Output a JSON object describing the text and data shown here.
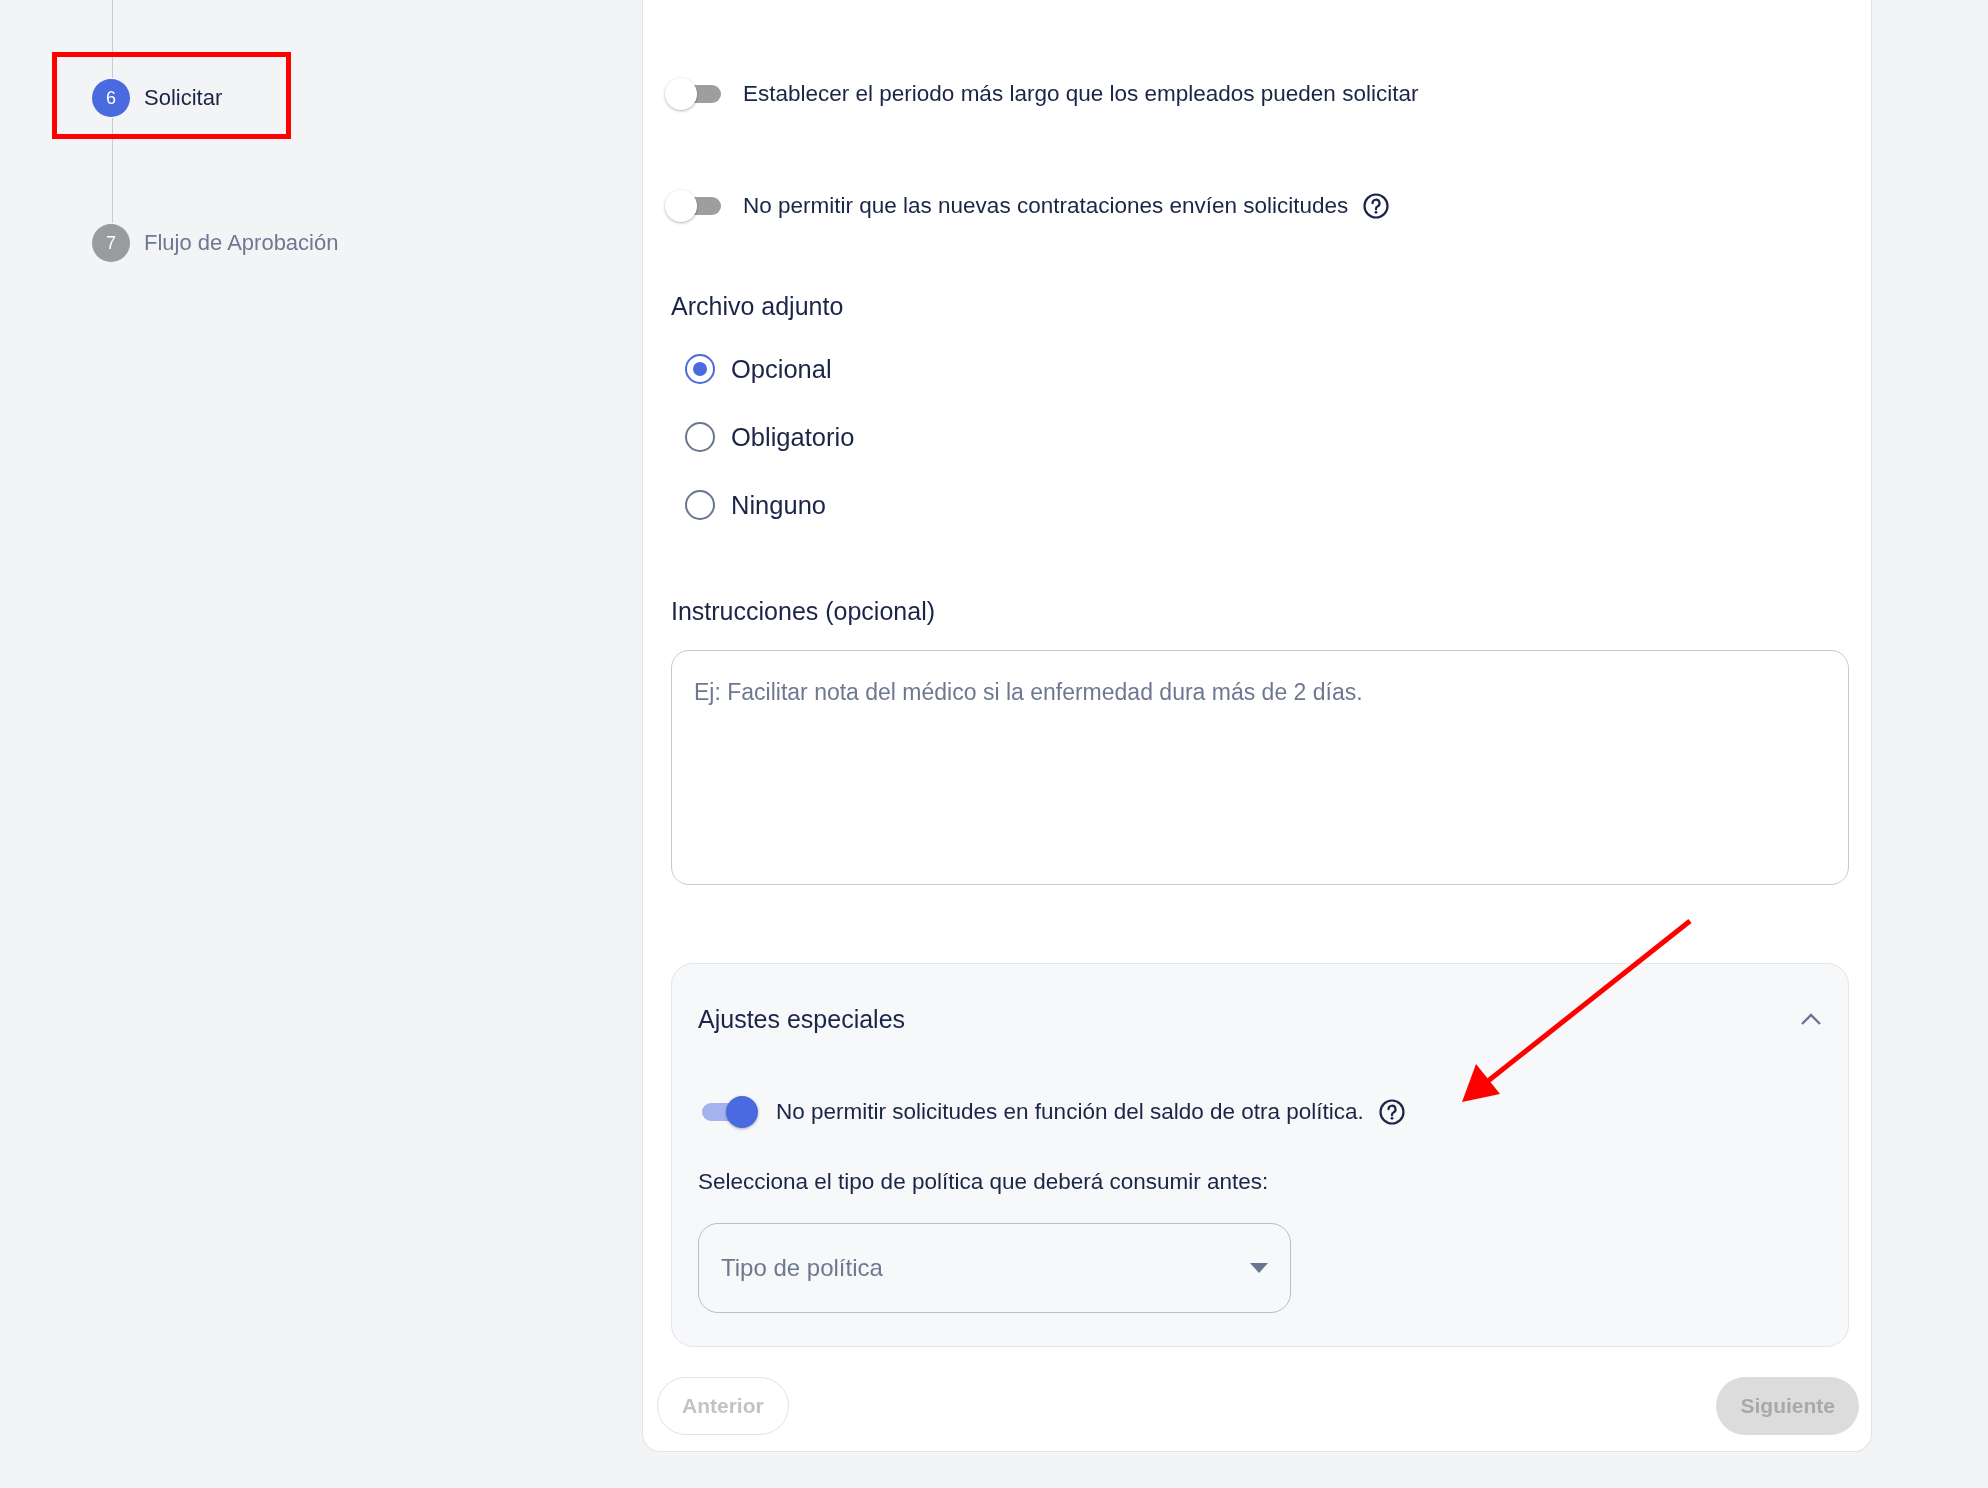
{
  "steps": [
    {
      "number": "6",
      "label": "Solicitar",
      "selected": true
    },
    {
      "number": "7",
      "label": "Flujo de Aprobación",
      "selected": false
    }
  ],
  "toggles": [
    {
      "label": "Establecer el periodo más largo que los empleados pueden solicitar",
      "on": false,
      "help": false
    },
    {
      "label": "No permitir que las nuevas contrataciones envíen solicitudes",
      "on": false,
      "help": true
    }
  ],
  "attachment": {
    "label": "Archivo adjunto",
    "options": [
      {
        "label": "Opcional",
        "selected": true
      },
      {
        "label": "Obligatorio",
        "selected": false
      },
      {
        "label": "Ninguno",
        "selected": false
      }
    ]
  },
  "instructions": {
    "label": "Instrucciones (opcional)",
    "placeholder": "Ej: Facilitar nota del médico si la enfermedad dura más de 2 días."
  },
  "special": {
    "title": "Ajustes especiales",
    "expanded": true,
    "toggle": {
      "label": "No permitir solicitudes en función del saldo de otra política.",
      "on": true,
      "help": true
    },
    "select_label": "Selecciona el tipo de política que deberá consumir antes:",
    "select": {
      "placeholder": "Tipo de política"
    }
  },
  "buttons": [
    {
      "label": "Anterior",
      "kind": "secondary",
      "disabled": true
    },
    {
      "label": "Siguiente",
      "kind": "primary",
      "disabled": true
    }
  ]
}
